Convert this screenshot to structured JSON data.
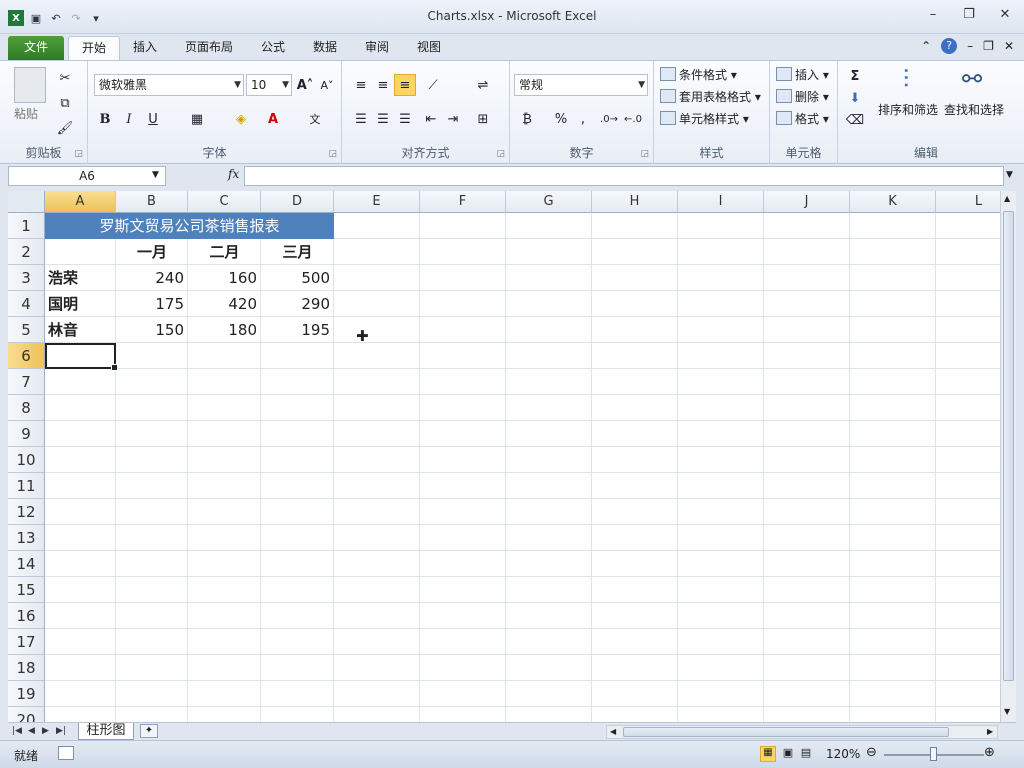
{
  "window": {
    "title": "Charts.xlsx - Microsoft Excel"
  },
  "tabs": [
    "文件",
    "开始",
    "插入",
    "页面布局",
    "公式",
    "数据",
    "审阅",
    "视图"
  ],
  "ribbon": {
    "clipboard": {
      "paste_label": "粘贴",
      "group_label": "剪贴板"
    },
    "font": {
      "name": "微软雅黑",
      "size": "10",
      "bold": "B",
      "italic": "I",
      "underline": "U",
      "group_label": "字体"
    },
    "alignment": {
      "group_label": "对齐方式"
    },
    "number": {
      "format": "常规",
      "percent": "%",
      "comma": ",",
      "group_label": "数字"
    },
    "styles": {
      "conditional": "条件格式",
      "table": "套用表格格式",
      "cell_styles": "单元格样式",
      "group_label": "样式"
    },
    "cells": {
      "insert": "插入",
      "delete": "删除",
      "format": "格式",
      "group_label": "单元格"
    },
    "editing": {
      "sort": "排序和筛选",
      "find": "查找和选择",
      "sigma": "Σ",
      "group_label": "编辑"
    }
  },
  "formula_bar": {
    "name_box": "A6",
    "fx": "fx",
    "formula": ""
  },
  "grid": {
    "columns": [
      "A",
      "B",
      "C",
      "D",
      "E",
      "F",
      "G",
      "H",
      "I",
      "J",
      "K",
      "L"
    ],
    "rows": [
      "1",
      "2",
      "3",
      "4",
      "5",
      "6",
      "7",
      "8",
      "9",
      "10",
      "11",
      "12",
      "13",
      "14",
      "15",
      "16",
      "17",
      "18",
      "19",
      "20"
    ],
    "title": "罗斯文贸易公司茶销售报表",
    "month_headers": [
      "一月",
      "二月",
      "三月"
    ],
    "data_rows": [
      {
        "name": "浩荣",
        "values": [
          "240",
          "160",
          "500"
        ]
      },
      {
        "name": "国明",
        "values": [
          "175",
          "420",
          "290"
        ]
      },
      {
        "name": "林音",
        "values": [
          "150",
          "180",
          "195"
        ]
      }
    ],
    "active_cell": "A6"
  },
  "sheet_tabs": [
    "柱形图"
  ],
  "status": {
    "text": "就绪",
    "zoom": "120%"
  }
}
